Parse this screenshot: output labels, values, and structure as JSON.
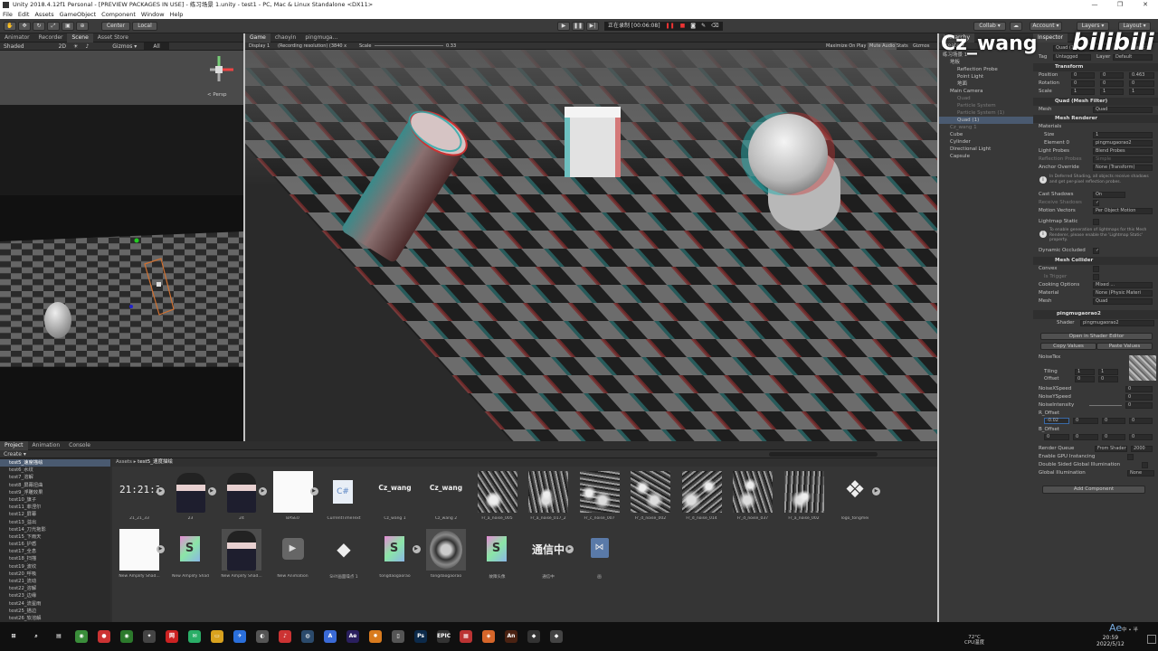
{
  "window": {
    "title": "Unity 2018.4.12f1 Personal - [PREVIEW PACKAGES IN USE] - 练习场景 1.unity - test1 - PC, Mac & Linux Standalone <DX11>",
    "controls": [
      "—",
      "❐",
      "✕"
    ]
  },
  "menu": [
    "File",
    "Edit",
    "Assets",
    "GameObject",
    "Component",
    "Window",
    "Help"
  ],
  "toolbar": {
    "pivot": "Center",
    "space": "Local",
    "recording": "正在录制 [00:06:08]",
    "collab": "Collab ▾",
    "account": "Account ▾",
    "layers": "Layers ▾",
    "layout": "Layout ▾"
  },
  "scene": {
    "tabs": [
      "Animator",
      "Recorder",
      "Scene",
      "Asset Store"
    ],
    "shading": "Shaded",
    "mode2d": "2D",
    "gizmos": "Gizmos ▾",
    "search": "All",
    "persp": "< Persp"
  },
  "game": {
    "tabs": [
      "Game",
      "chaoyin",
      "pingmuga..."
    ],
    "display": "Display 1",
    "resolution": "(Recording resolution) (3840 x",
    "scale_label": "Scale",
    "scale_value": "0.33",
    "options": [
      "Maximize On Play",
      "Mute Audio",
      "Stats",
      "Gizmos"
    ]
  },
  "watermark": {
    "user": "Cz_wang",
    "brand": "bilibili"
  },
  "hierarchy": {
    "tab": "Hierarchy",
    "create": "Create ▾",
    "items": [
      {
        "label": "练习场景 1",
        "indent": 0,
        "dim": false,
        "sel": false
      },
      {
        "label": "地板",
        "indent": 1,
        "dim": false,
        "sel": false
      },
      {
        "label": "Reflection Probe",
        "indent": 2,
        "dim": false,
        "sel": false
      },
      {
        "label": "Point Light",
        "indent": 2,
        "dim": false,
        "sel": false
      },
      {
        "label": "地面",
        "indent": 2,
        "dim": false,
        "sel": false
      },
      {
        "label": "Main Camera",
        "indent": 1,
        "dim": false,
        "sel": false
      },
      {
        "label": "Quad",
        "indent": 2,
        "dim": true,
        "sel": false
      },
      {
        "label": "Particle System",
        "indent": 2,
        "dim": true,
        "sel": false
      },
      {
        "label": "Particle System (1)",
        "indent": 2,
        "dim": true,
        "sel": false
      },
      {
        "label": "Quad (1)",
        "indent": 2,
        "dim": false,
        "sel": true
      },
      {
        "label": "Cz_wang 1",
        "indent": 1,
        "dim": true,
        "sel": false
      },
      {
        "label": "Cube",
        "indent": 1,
        "dim": false,
        "sel": false
      },
      {
        "label": "Cylinder",
        "indent": 1,
        "dim": false,
        "sel": false
      },
      {
        "label": "Directional Light",
        "indent": 1,
        "dim": false,
        "sel": false
      },
      {
        "label": "Capsule",
        "indent": 1,
        "dim": false,
        "sel": false
      }
    ]
  },
  "inspector": {
    "tab": "Inspector",
    "object": "Quad (1)",
    "static": "Static ▾",
    "tag_label": "Tag",
    "tag": "Untagged",
    "layer_label": "Layer",
    "layer": "Default",
    "transform": {
      "title": "Transform",
      "position": {
        "label": "Position",
        "x": "0",
        "y": "0",
        "z": "0.463"
      },
      "rotation": {
        "label": "Rotation",
        "x": "0",
        "y": "0",
        "z": "0"
      },
      "scale": {
        "label": "Scale",
        "x": "1",
        "y": "1",
        "z": "1"
      }
    },
    "meshfilter": {
      "title": "Quad (Mesh Filter)",
      "mesh_label": "Mesh",
      "mesh": "Quad"
    },
    "meshrenderer": {
      "title": "Mesh Renderer",
      "materials": "Materials",
      "size_label": "Size",
      "size": "1",
      "element_label": "Element 0",
      "element": "pingmugaorao2",
      "light_probes_label": "Light Probes",
      "light_probes": "Blend Probes",
      "reflection_probes_label": "Reflection Probes",
      "reflection_probes": "Simple",
      "anchor_label": "Anchor Override",
      "anchor": "None (Transform)",
      "info1": "In Deferred Shading, all objects receive shadows and get per-pixel reflection probes.",
      "cast_label": "Cast Shadows",
      "cast": "On",
      "receive_label": "Receive Shadows",
      "motion_label": "Motion Vectors",
      "motion": "Per Object Motion",
      "lightmap_label": "Lightmap Static",
      "info2": "To enable generation of lightmaps for this Mesh Renderer, please enable the 'Lightmap Static' property.",
      "dyn_label": "Dynamic Occluded"
    },
    "meshcollider": {
      "title": "Mesh Collider",
      "convex": "Convex",
      "trigger": "Is Trigger",
      "cooking_label": "Cooking Options",
      "cooking": "Mixed ...",
      "material_label": "Material",
      "material": "None (Physic Materi",
      "mesh_label": "Mesh",
      "mesh": "Quad"
    },
    "material": {
      "name": "pingmugaorao2",
      "shader_label": "Shader",
      "shader": "pingmugaorao2",
      "btn_shader": "Open in Shader Editor",
      "btn_copy": "Copy Values",
      "btn_paste": "Paste Values",
      "noisetex": "NoiseTex",
      "tiling": {
        "label": "Tiling",
        "x": "1",
        "y": "1"
      },
      "offset": {
        "label": "Offset",
        "x": "0",
        "y": "0"
      },
      "nx": {
        "label": "NoiseXSpeed",
        "v": "0"
      },
      "ny": {
        "label": "NoiseYSpeed",
        "v": "0"
      },
      "ni": {
        "label": "NoiseIntensity",
        "v": "0"
      },
      "r_offset": {
        "label": "R_Offset",
        "x": "-0.02",
        "y": "0",
        "z": "0",
        "w": "0"
      },
      "b_offset": {
        "label": "B_Offset",
        "x": "0",
        "y": "0",
        "z": "0",
        "w": "0"
      },
      "queue_label": "Render Queue",
      "queue_mode": "From Shader",
      "queue": "2000",
      "gpu": "Enable GPU Instancing",
      "dsgi": "Double Sided Global Illumination",
      "gi_label": "Global Illumination",
      "gi": "None"
    },
    "add_component": "Add Component"
  },
  "project": {
    "tabs": [
      "Project",
      "Animation",
      "Console"
    ],
    "create": "Create ▾",
    "breadcrumb": [
      "Assets",
      "test5_速度描绘"
    ],
    "tree": [
      "test5_速度描绘",
      "test6_水纹",
      "test7_溶解",
      "test8_屏幕扭曲",
      "test9_浮雕效果",
      "test10_旗子",
      "test11_菲涅尔",
      "test12_屏幕",
      "test13_溢出",
      "test14_刀光拖影",
      "test15_下雨天",
      "test16_护盾",
      "test17_全息",
      "test18_扫描",
      "test19_波纹",
      "test20_呼吸",
      "test21_流动",
      "test22_溶解",
      "test23_边缘",
      "test24_流星雨",
      "test25_描边",
      "test26_软溶解",
      "test27_扭曲"
    ],
    "assets": [
      {
        "label": "21_21_33",
        "kind": "clock",
        "text": "21:21:3"
      },
      {
        "label": "23",
        "kind": "char"
      },
      {
        "label": "24",
        "kind": "char"
      },
      {
        "label": "BASE0",
        "kind": "white"
      },
      {
        "label": "CurrentTimeText",
        "kind": "cs"
      },
      {
        "label": "Cz_wang 1",
        "kind": "text",
        "text": "Cz_wang"
      },
      {
        "label": "Cz_wang 2",
        "kind": "text",
        "text": "Cz_wang"
      },
      {
        "label": "Fr_a_noise_005",
        "kind": "noise"
      },
      {
        "label": "Fr_a_noise_017_2",
        "kind": "noise"
      },
      {
        "label": "Fr_c_noise_007",
        "kind": "noise"
      },
      {
        "label": "Fr_d_noise_002",
        "kind": "noise"
      },
      {
        "label": "Fr_d_noise_014",
        "kind": "noise"
      },
      {
        "label": "Fr_d_noise_037",
        "kind": "noise"
      },
      {
        "label": "Fr_a_noise_002",
        "kind": "noise"
      },
      {
        "label": "logo_tongmei",
        "kind": "logo"
      },
      {
        "label": "New Amplify Shad...",
        "kind": "white"
      },
      {
        "label": "New Amplify Shad",
        "kind": "shader"
      },
      {
        "label": "New Amplify Shad...",
        "kind": "char"
      },
      {
        "label": "New Animation",
        "kind": "anim"
      },
      {
        "label": "SHY画面噪点 1",
        "kind": "unity"
      },
      {
        "label": "tongdaogaorao",
        "kind": "shader"
      },
      {
        "label": "tongdaogaorao",
        "kind": "char2"
      },
      {
        "label": "故障头像",
        "kind": "shader"
      },
      {
        "label": "通信中",
        "kind": "text",
        "text": "通信中"
      },
      {
        "label": "画",
        "kind": "graph"
      }
    ]
  },
  "taskbar": {
    "temp": "72°C",
    "temp_sub": "CPU温度",
    "time": "20:59",
    "date": "2022/5/12",
    "lang": "Ae",
    "ime": "中 ∙ 半",
    "icons": [
      {
        "name": "windows-icon",
        "t": "⊞",
        "c": "#101010"
      },
      {
        "name": "search-icon",
        "t": "⌕",
        "c": "#101010"
      },
      {
        "name": "taskview-icon",
        "t": "▤",
        "c": "#101010"
      },
      {
        "name": "chrome-icon",
        "t": "◉",
        "c": "#3a8d3a"
      },
      {
        "name": "record-icon",
        "t": "●",
        "c": "#c33"
      },
      {
        "name": "chrome-green-icon",
        "t": "◉",
        "c": "#2c7a2c"
      },
      {
        "name": "app-icon",
        "t": "✦",
        "c": "#444"
      },
      {
        "name": "netease-icon",
        "t": "网",
        "c": "#c22"
      },
      {
        "name": "wechat-icon",
        "t": "✉",
        "c": "#2aae67"
      },
      {
        "name": "folder-icon",
        "t": "▭",
        "c": "#d9a21e"
      },
      {
        "name": "feishu-icon",
        "t": "✈",
        "c": "#2a6fdb"
      },
      {
        "name": "app-icon",
        "t": "◐",
        "c": "#555"
      },
      {
        "name": "music-icon",
        "t": "♪",
        "c": "#c33"
      },
      {
        "name": "steam-icon",
        "t": "◍",
        "c": "#2b4a6b"
      },
      {
        "name": "app-icon",
        "t": "A",
        "c": "#3a6ad6"
      },
      {
        "name": "ae-icon",
        "t": "Ae",
        "c": "#2a1f5e"
      },
      {
        "name": "blender-icon",
        "t": "✹",
        "c": "#d97b1e"
      },
      {
        "name": "app-icon",
        "t": "▯",
        "c": "#555"
      },
      {
        "name": "ps-icon",
        "t": "Ps",
        "c": "#0c2a4a"
      },
      {
        "name": "epic-icon",
        "t": "EPIC",
        "c": "#333"
      },
      {
        "name": "app-icon",
        "t": "▦",
        "c": "#b33"
      },
      {
        "name": "app-icon",
        "t": "◈",
        "c": "#d6662a"
      },
      {
        "name": "an-icon",
        "t": "An",
        "c": "#4a2212"
      },
      {
        "name": "unity-icon",
        "t": "◆",
        "c": "#333"
      },
      {
        "name": "unity-editor-icon",
        "t": "◆",
        "c": "#444"
      }
    ]
  }
}
